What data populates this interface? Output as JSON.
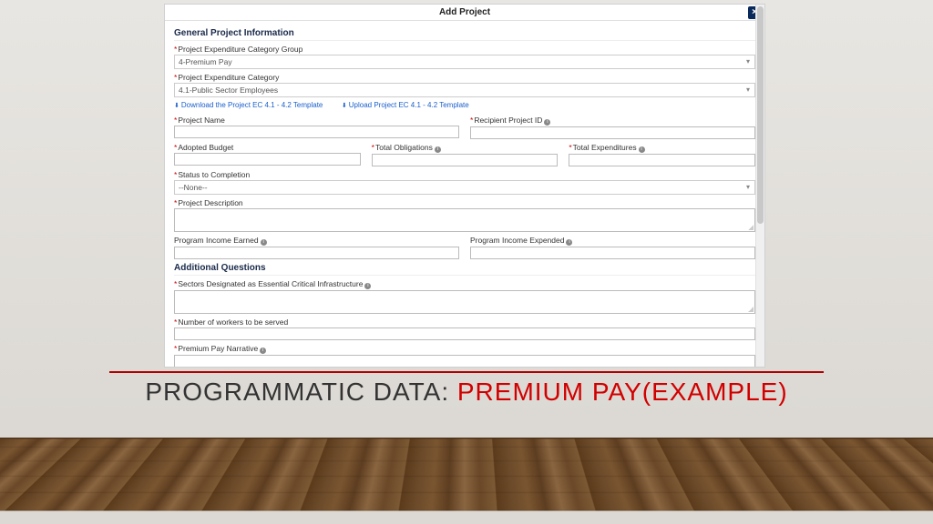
{
  "slide": {
    "title_black": "PROGRAMMATIC DATA: ",
    "title_red": "PREMIUM PAY(EXAMPLE)"
  },
  "form": {
    "header": "Add Project",
    "close": "×",
    "section1": "General Project Information",
    "catGroupLabel": "Project Expenditure Category Group",
    "catGroupValue": "4-Premium Pay",
    "catLabel": "Project Expenditure Category",
    "catValue": "4.1-Public Sector Employees",
    "link1": "Download the Project EC 4.1 - 4.2 Template",
    "link2": "Upload Project EC 4.1 - 4.2 Template",
    "projName": "Project Name",
    "recipId": "Recipient Project ID",
    "adopted": "Adopted Budget",
    "totalOblig": "Total Obligations",
    "totalExp": "Total Expenditures",
    "status": "Status to Completion",
    "statusValue": "--None--",
    "desc": "Project Description",
    "incomeEarned": "Program Income Earned",
    "incomeExpended": "Program Income Expended",
    "section2": "Additional Questions",
    "sectors": "Sectors Designated as Essential Critical Infrastructure",
    "workers": "Number of workers to be served",
    "narrative": "Premium Pay Narrative"
  }
}
